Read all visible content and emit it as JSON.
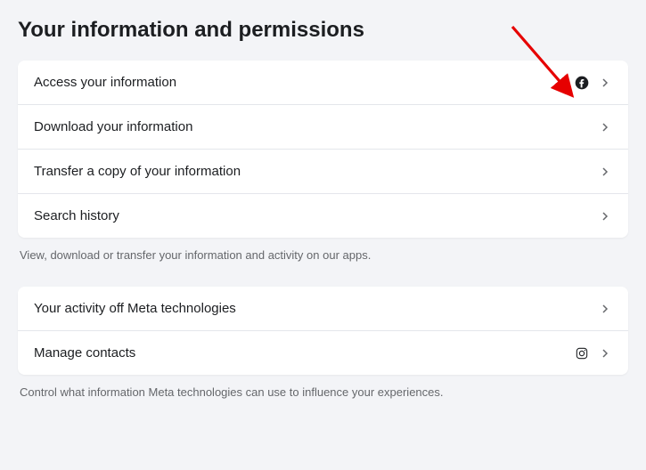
{
  "header": {
    "title": "Your information and permissions"
  },
  "sections": [
    {
      "items": [
        {
          "label": "Access your information",
          "icon": "facebook"
        },
        {
          "label": "Download your information",
          "icon": null
        },
        {
          "label": "Transfer a copy of your information",
          "icon": null
        },
        {
          "label": "Search history",
          "icon": null
        }
      ],
      "caption": "View, download or transfer your information and activity on our apps."
    },
    {
      "items": [
        {
          "label": "Your activity off Meta technologies",
          "icon": null
        },
        {
          "label": "Manage contacts",
          "icon": "instagram"
        }
      ],
      "caption": "Control what information Meta technologies can use to influence your experiences."
    }
  ],
  "annotation": {
    "arrow_color": "#e60000"
  }
}
